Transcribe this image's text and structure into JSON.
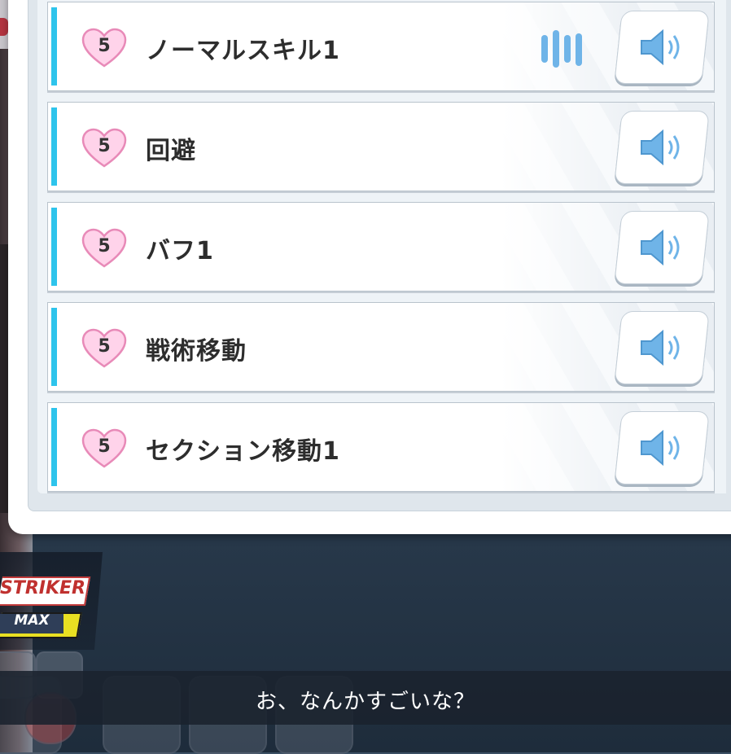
{
  "voice_list": {
    "rows": [
      {
        "level": "5",
        "label": "ノーマルスキル1",
        "playing": true
      },
      {
        "level": "5",
        "label": "回避",
        "playing": false
      },
      {
        "level": "5",
        "label": "バフ1",
        "playing": false
      },
      {
        "level": "5",
        "label": "戦術移動",
        "playing": false
      },
      {
        "level": "5",
        "label": "セクション移動1",
        "playing": false
      }
    ],
    "icons": {
      "level_badge": "heart-icon",
      "play": "speaker-icon",
      "playing_indicator": "audio-wave-icon"
    }
  },
  "hud": {
    "role_label": "STRIKER",
    "level_label": "MAX"
  },
  "subtitle": {
    "text": "お、なんかすごいな？"
  },
  "colors": {
    "accent": "#2ec4ec",
    "heart_fill": "#ffd3ea",
    "heart_stroke": "#e88ab8",
    "speaker": "#6fb4e8",
    "striker_red": "#c0312f",
    "max_yellow": "#e9e022"
  }
}
